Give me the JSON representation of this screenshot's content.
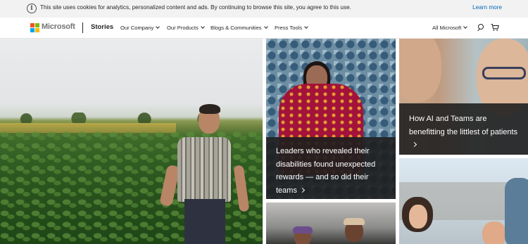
{
  "cookie_banner": {
    "icon": "info-icon",
    "message": "This site uses cookies for analytics, personalized content and ads. By continuing to browse this site, you agree to this use.",
    "learn_more": "Learn more"
  },
  "header": {
    "brand": "Microsoft",
    "section": "Stories",
    "nav": [
      {
        "label": "Our Company"
      },
      {
        "label": "Our Products"
      },
      {
        "label": "Blogs & Communities"
      },
      {
        "label": "Press Tools"
      }
    ],
    "all_microsoft": "All Microsoft",
    "icons": [
      "search-icon",
      "cart-icon"
    ]
  },
  "stories": [
    {
      "caption": "Leaders who revealed their disabilities found unexpected rewards — and so did their teams"
    },
    {
      "caption": "How AI and Teams are benefitting the littlest of patients"
    }
  ],
  "colors": {
    "link": "#0067b8",
    "caption_bg": "#202020",
    "banner_bg": "#f2f2f2"
  }
}
